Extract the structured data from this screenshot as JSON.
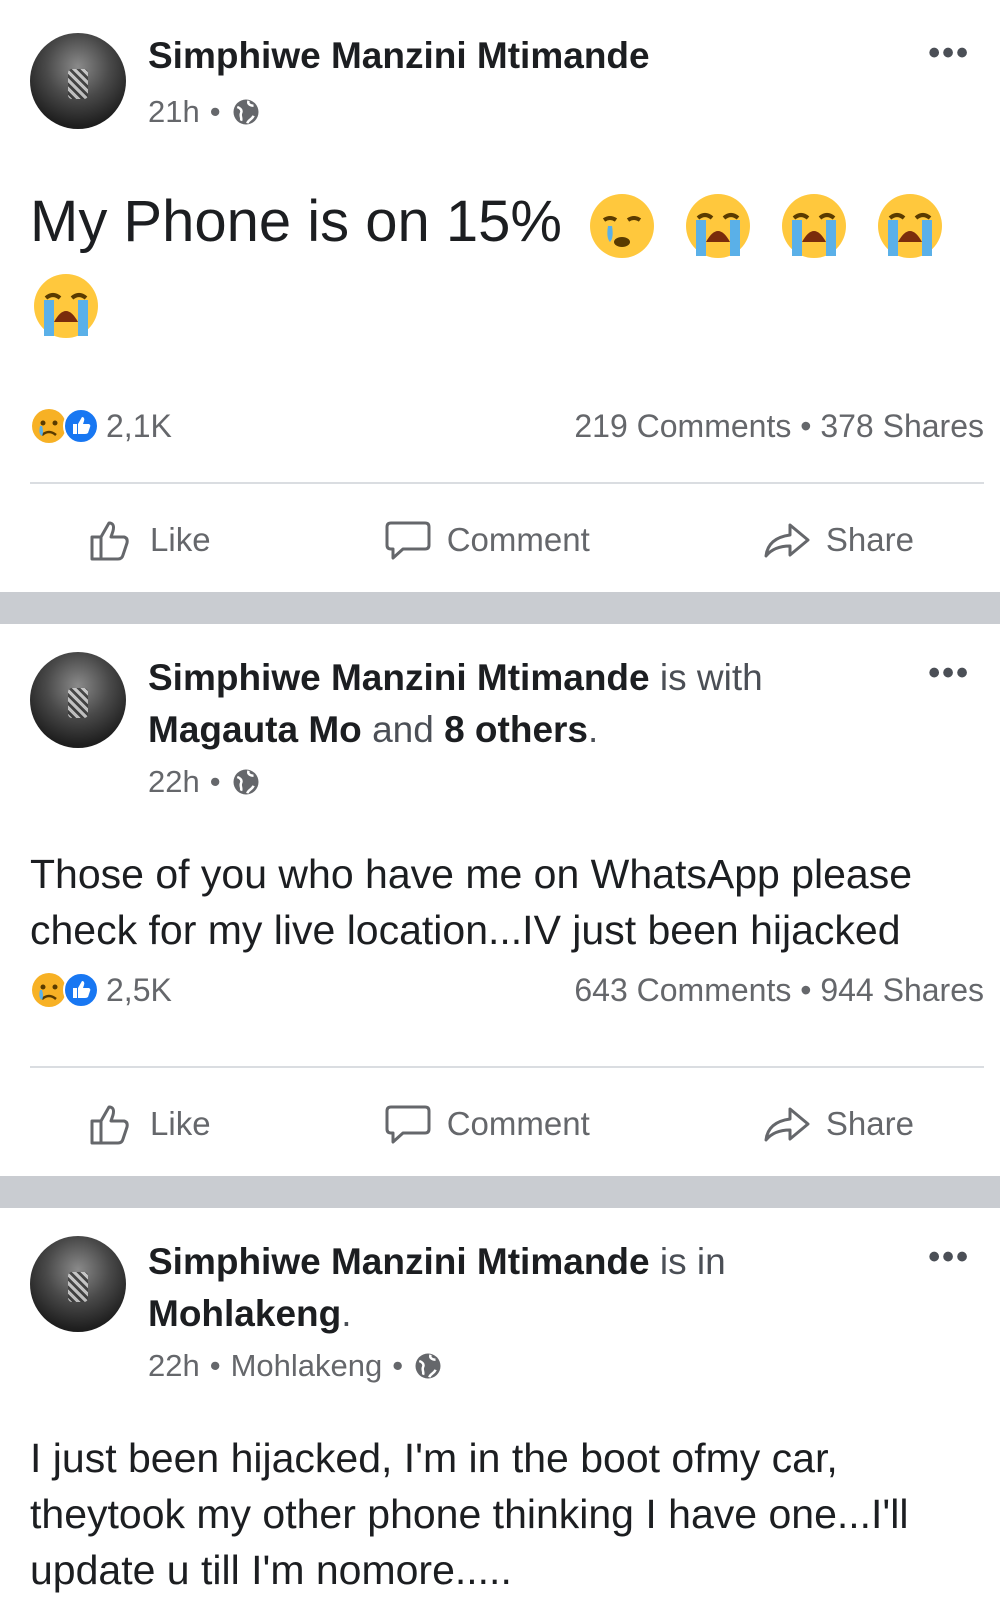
{
  "posts": [
    {
      "author": "Simphiwe Manzini Mtimande",
      "time": "21h",
      "dot": "•",
      "text": "My Phone is on 15%",
      "reactions_count": "2,1K",
      "comments": "219 Comments",
      "shares": "378 Shares",
      "like": "Like",
      "comment": "Comment",
      "share": "Share"
    },
    {
      "author": "Simphiwe Manzini Mtimande",
      "with_text": "is with",
      "tagged": "Magauta Mo",
      "and_text": "and",
      "others": "8 others",
      "period": ".",
      "time": "22h",
      "dot": "•",
      "text": "Those of you who have me on WhatsApp please check for my live location...IV just been hijacked",
      "reactions_count": "2,5K",
      "comments": "643 Comments",
      "shares": "944 Shares",
      "like": "Like",
      "comment": "Comment",
      "share": "Share"
    },
    {
      "author": "Simphiwe Manzini Mtimande",
      "in_text": "is in",
      "place": "Mohlakeng",
      "period": ".",
      "time": "22h",
      "location": "Mohlakeng",
      "dot": "•",
      "text": "I just been hijacked, I'm in the boot ofmy car, theytook my other phone thinking I have one...I'll update u till I'm nomore....."
    }
  ],
  "more": "•••",
  "colors": {
    "like_blue": "#1877f2",
    "text": "#1c1e21",
    "secondary": "#65676b",
    "separator": "#c9ccd1"
  },
  "icons": [
    "globe-icon",
    "more-icon",
    "crying-face-icon",
    "loudly-crying-face-icon",
    "sad-reaction-icon",
    "like-reaction-icon",
    "thumbs-up-icon",
    "comment-bubble-icon",
    "share-arrow-icon"
  ]
}
